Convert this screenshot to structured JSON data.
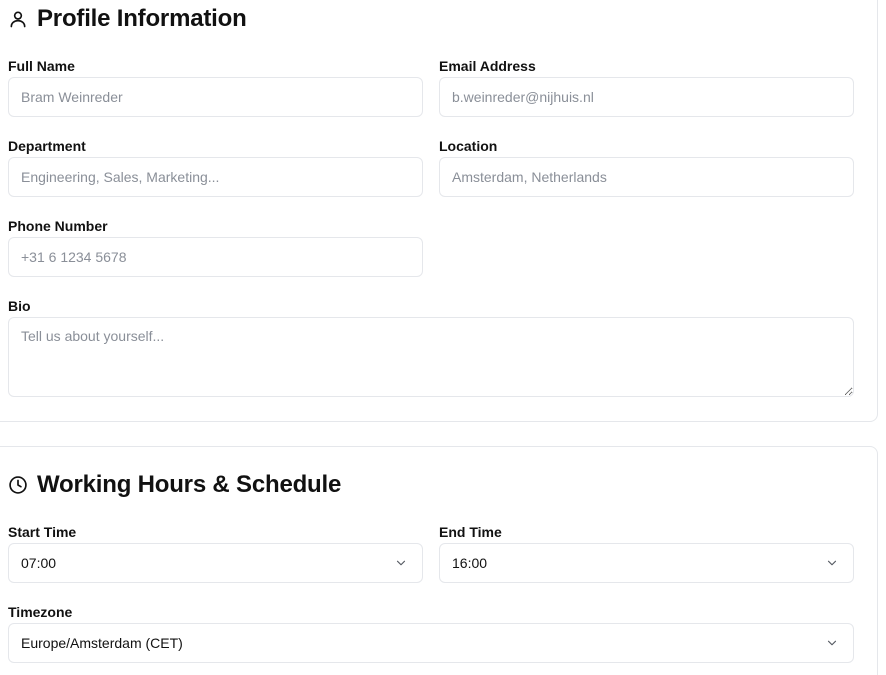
{
  "profile": {
    "title": "Profile Information",
    "icon": "user-icon",
    "fields": {
      "full_name": {
        "label": "Full Name",
        "placeholder": "Bram Weinreder"
      },
      "email": {
        "label": "Email Address",
        "placeholder": "b.weinreder@nijhuis.nl"
      },
      "department": {
        "label": "Department",
        "placeholder": "Engineering, Sales, Marketing..."
      },
      "location": {
        "label": "Location",
        "placeholder": "Amsterdam, Netherlands"
      },
      "phone": {
        "label": "Phone Number",
        "placeholder": "+31 6 1234 5678"
      },
      "bio": {
        "label": "Bio",
        "placeholder": "Tell us about yourself..."
      }
    }
  },
  "working_hours": {
    "title": "Working Hours & Schedule",
    "icon": "clock-icon",
    "start_time": {
      "label": "Start Time",
      "value": "07:00"
    },
    "end_time": {
      "label": "End Time",
      "value": "16:00"
    },
    "timezone": {
      "label": "Timezone",
      "value": "Europe/Amsterdam (CET)"
    }
  },
  "colors": {
    "border": "#e5e7eb",
    "placeholder": "#8a8f98",
    "text": "#111111"
  }
}
